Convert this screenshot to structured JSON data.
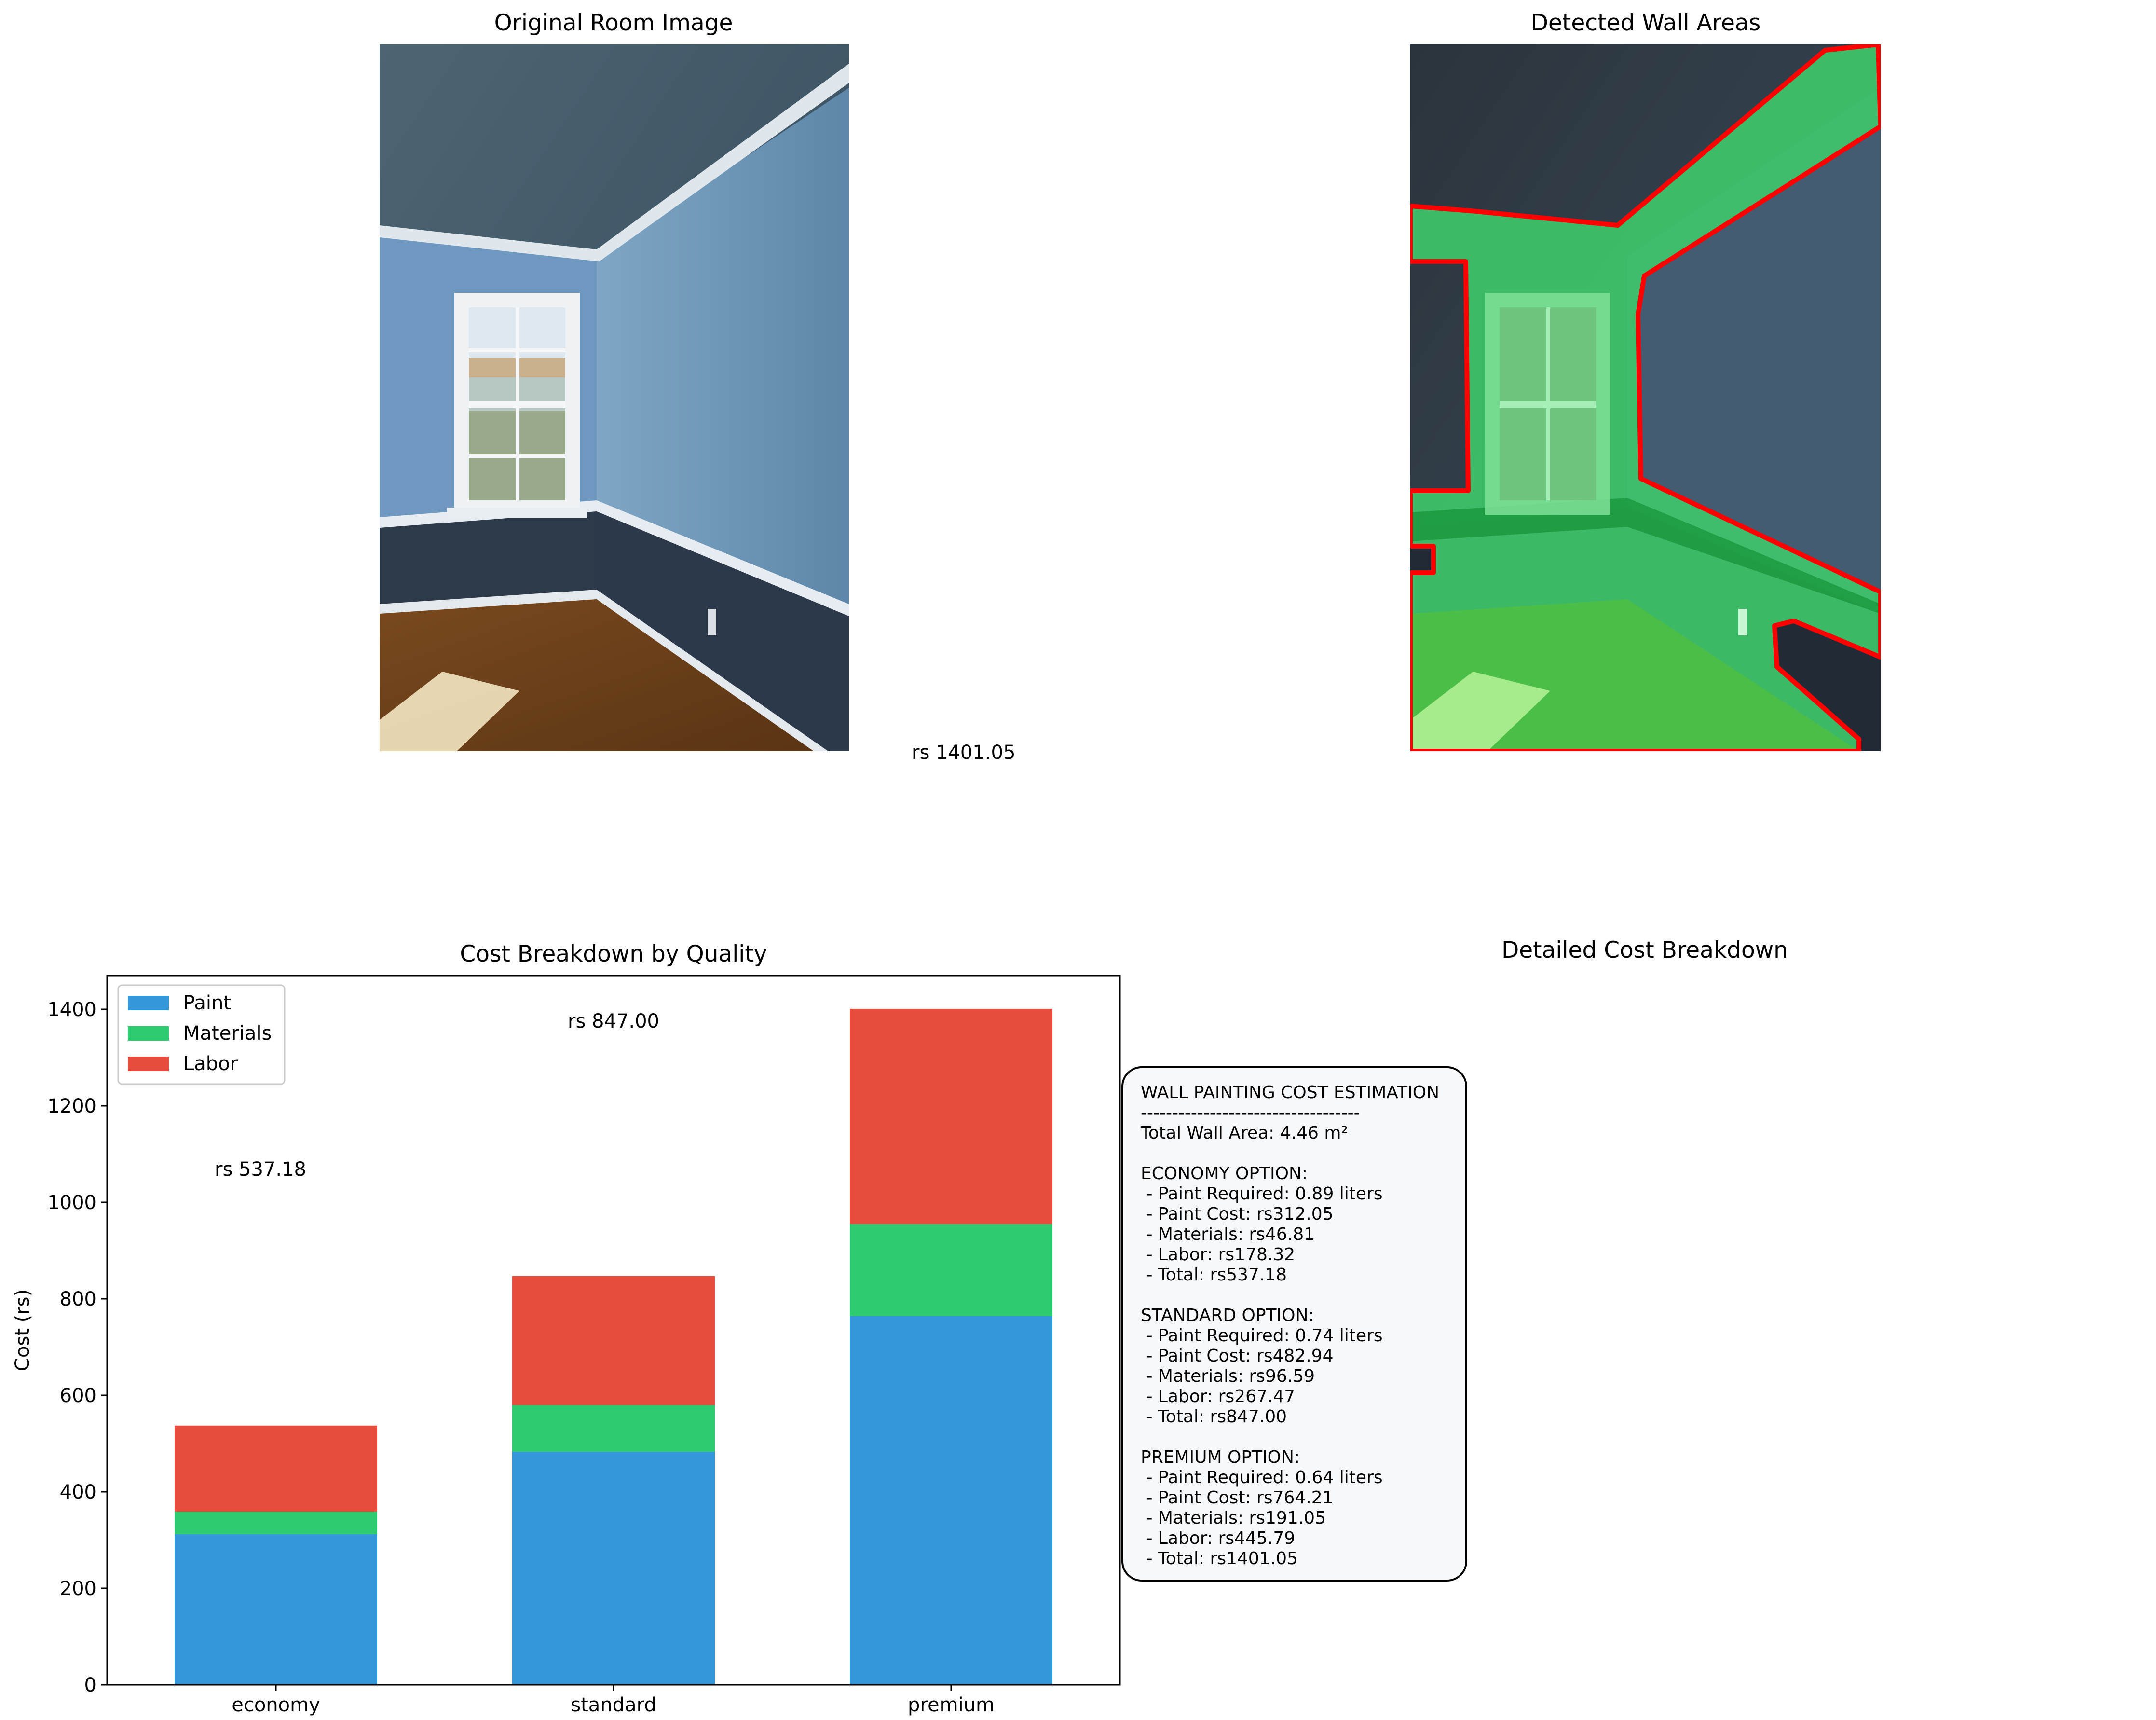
{
  "panels": {
    "original": {
      "title": "Original Room Image"
    },
    "detected": {
      "title": "Detected Wall Areas"
    },
    "breakdown": {
      "title": "Detailed Cost Breakdown"
    }
  },
  "premium_total_note": "rs 1401.05",
  "summary_text": "WALL PAINTING COST ESTIMATION\n-----------------------------------\nTotal Wall Area: 4.46 m²\n\nECONOMY OPTION:\n - Paint Required: 0.89 liters\n - Paint Cost: rs312.05\n - Materials: rs46.81\n - Labor: rs178.32\n - Total: rs537.18\n\nSTANDARD OPTION:\n - Paint Required: 0.74 liters\n - Paint Cost: rs482.94\n - Materials: rs96.59\n - Labor: rs267.47\n - Total: rs847.00\n\nPREMIUM OPTION:\n - Paint Required: 0.64 liters\n - Paint Cost: rs764.21\n - Materials: rs191.05\n - Labor: rs445.79\n - Total: rs1401.05",
  "colors": {
    "paint": "#3498db",
    "materials": "#2ecc71",
    "labor": "#e74c3c",
    "outline": "#ff0000",
    "box_bg": "#f7f8fa"
  },
  "chart_data": {
    "type": "bar",
    "stacked": true,
    "title": "Cost Breakdown by Quality",
    "xlabel": "",
    "ylabel": "Cost (rs)",
    "categories": [
      "economy",
      "standard",
      "premium"
    ],
    "series": [
      {
        "name": "Paint",
        "values": [
          312.05,
          482.94,
          764.21
        ]
      },
      {
        "name": "Materials",
        "values": [
          46.81,
          96.59,
          191.05
        ]
      },
      {
        "name": "Labor",
        "values": [
          178.32,
          267.47,
          445.79
        ]
      }
    ],
    "totals_labels": [
      "rs 537.18",
      "rs 847.00"
    ],
    "ylim": [
      0,
      1470
    ],
    "yticks": [
      0,
      200,
      400,
      600,
      800,
      1000,
      1200,
      1400
    ],
    "legend": "top-left",
    "grid": false
  }
}
